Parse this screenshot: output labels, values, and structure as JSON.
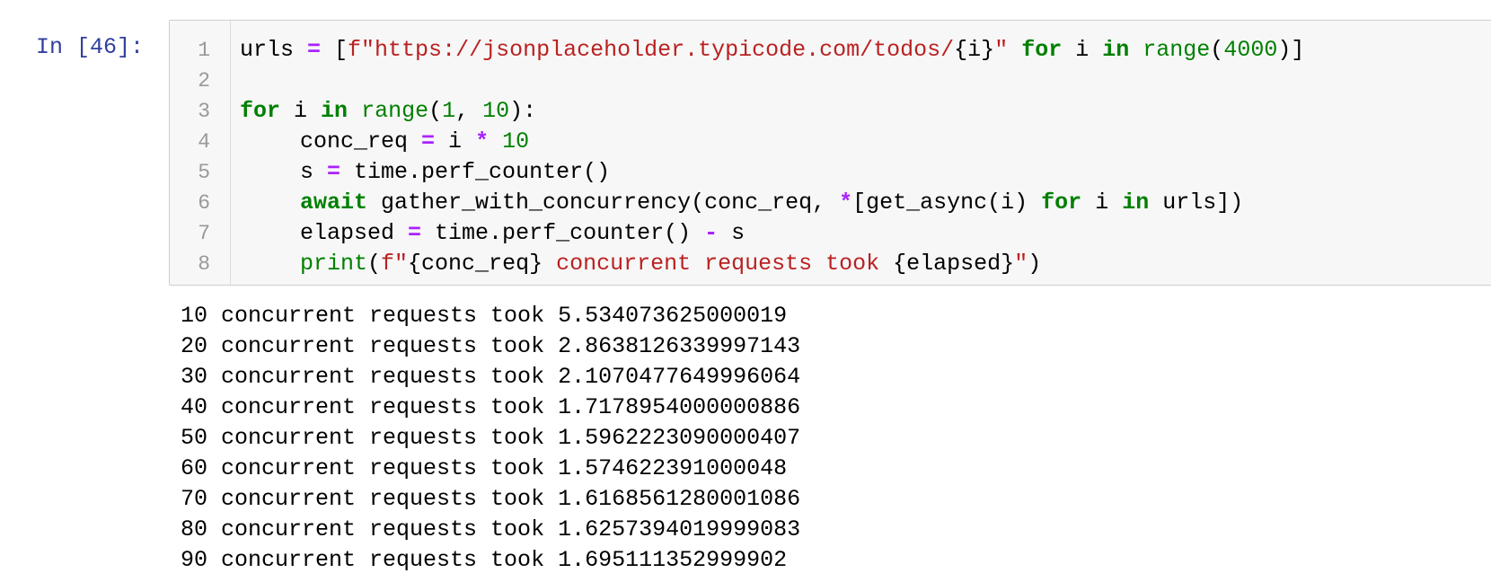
{
  "cell": {
    "prompt": "In [46]:",
    "line_numbers": [
      "1",
      "2",
      "3",
      "4",
      "5",
      "6",
      "7",
      "8"
    ],
    "code": {
      "l1": {
        "a": "urls ",
        "b": "=",
        "c": " [",
        "d": "f\"https://jsonplaceholder.typicode.com/todos/",
        "e": "{i}",
        "f": "\"",
        "g": " ",
        "h": "for",
        "i": " i ",
        "j": "in",
        "k": " ",
        "l": "range",
        "m": "(",
        "n": "4000",
        "o": ")]"
      },
      "l3": {
        "a": "for",
        "b": " i ",
        "c": "in",
        "d": " ",
        "e": "range",
        "f": "(",
        "g": "1",
        "h": ", ",
        "i": "10",
        "j": "):"
      },
      "l4": {
        "a": "conc_req ",
        "b": "=",
        "c": " i ",
        "d": "*",
        "e": " ",
        "f": "10"
      },
      "l5": {
        "a": "s ",
        "b": "=",
        "c": " time.perf_counter()"
      },
      "l6": {
        "a": "await",
        "b": " gather_with_concurrency(conc_req, ",
        "c": "*",
        "d": "[get_async(i) ",
        "e": "for",
        "f": " i ",
        "g": "in",
        "h": " urls])"
      },
      "l7": {
        "a": "elapsed ",
        "b": "=",
        "c": " time.perf_counter() ",
        "d": "-",
        "e": " s"
      },
      "l8": {
        "a": "print",
        "b": "(",
        "c": "f\"",
        "d": "{conc_req}",
        "e": " concurrent requests took ",
        "f": "{elapsed}",
        "g": "\"",
        "h": ")"
      }
    },
    "output": [
      "10 concurrent requests took 5.534073625000019",
      "20 concurrent requests took 2.8638126339997143",
      "30 concurrent requests took 2.1070477649996064",
      "40 concurrent requests took 1.7178954000000886",
      "50 concurrent requests took 1.5962223090000407",
      "60 concurrent requests took 1.574622391000048",
      "70 concurrent requests took 1.6168561280001086",
      "80 concurrent requests took 1.6257394019999083",
      "90 concurrent requests took 1.695111352999902"
    ]
  }
}
